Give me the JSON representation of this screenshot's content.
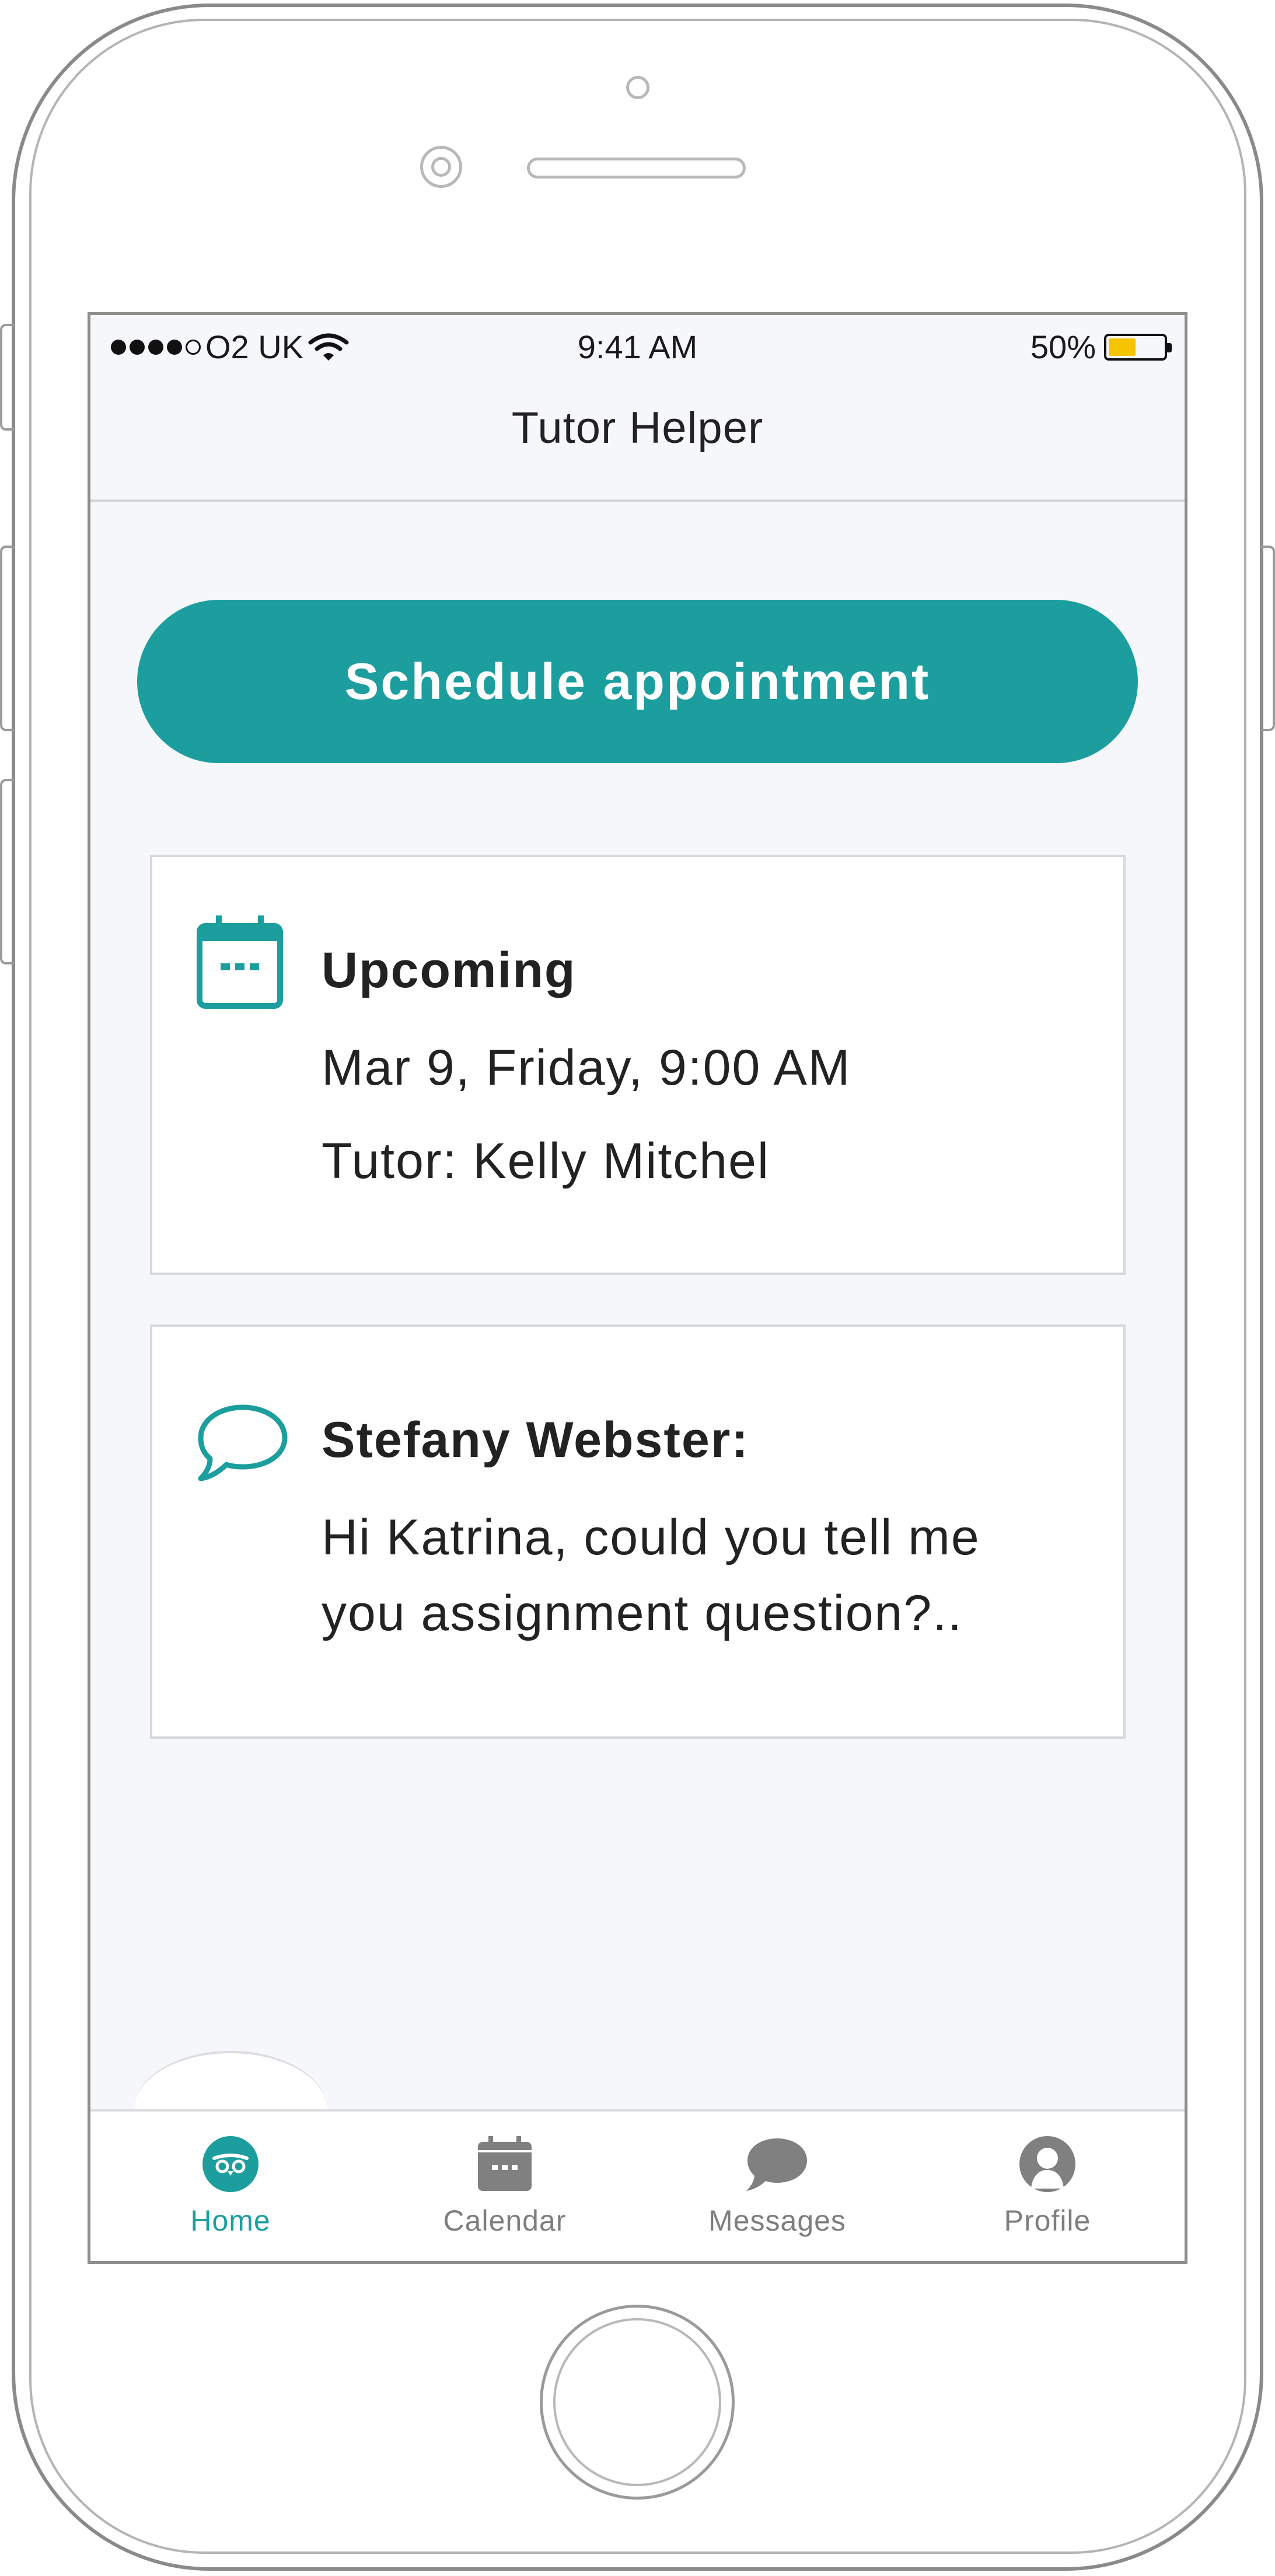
{
  "status_bar": {
    "carrier": "O2 UK",
    "time": "9:41 AM",
    "battery_percent": "50%",
    "battery_level": 0.5,
    "signal_bars": 4
  },
  "nav": {
    "title": "Tutor Helper"
  },
  "schedule_button": {
    "label": "Schedule appointment"
  },
  "upcoming": {
    "title": "Upcoming",
    "datetime": "Mar 9, Friday, 9:00 AM",
    "tutor": "Tutor: Kelly Mitchel"
  },
  "message": {
    "sender": "Stefany Webster:",
    "line1": "Hi Katrina, could you tell me",
    "line2": "you assignment question?.."
  },
  "tabs": [
    {
      "label": "Home",
      "icon": "owl-icon",
      "active": true
    },
    {
      "label": "Calendar",
      "icon": "calendar-icon",
      "active": false
    },
    {
      "label": "Messages",
      "icon": "chat-bubble-icon",
      "active": false
    },
    {
      "label": "Profile",
      "icon": "person-icon",
      "active": false
    }
  ],
  "colors": {
    "accent": "#1c9e9e",
    "battery": "#f5c400",
    "inactive_tab": "#7e7e7e",
    "background": "#f6f7fa"
  }
}
